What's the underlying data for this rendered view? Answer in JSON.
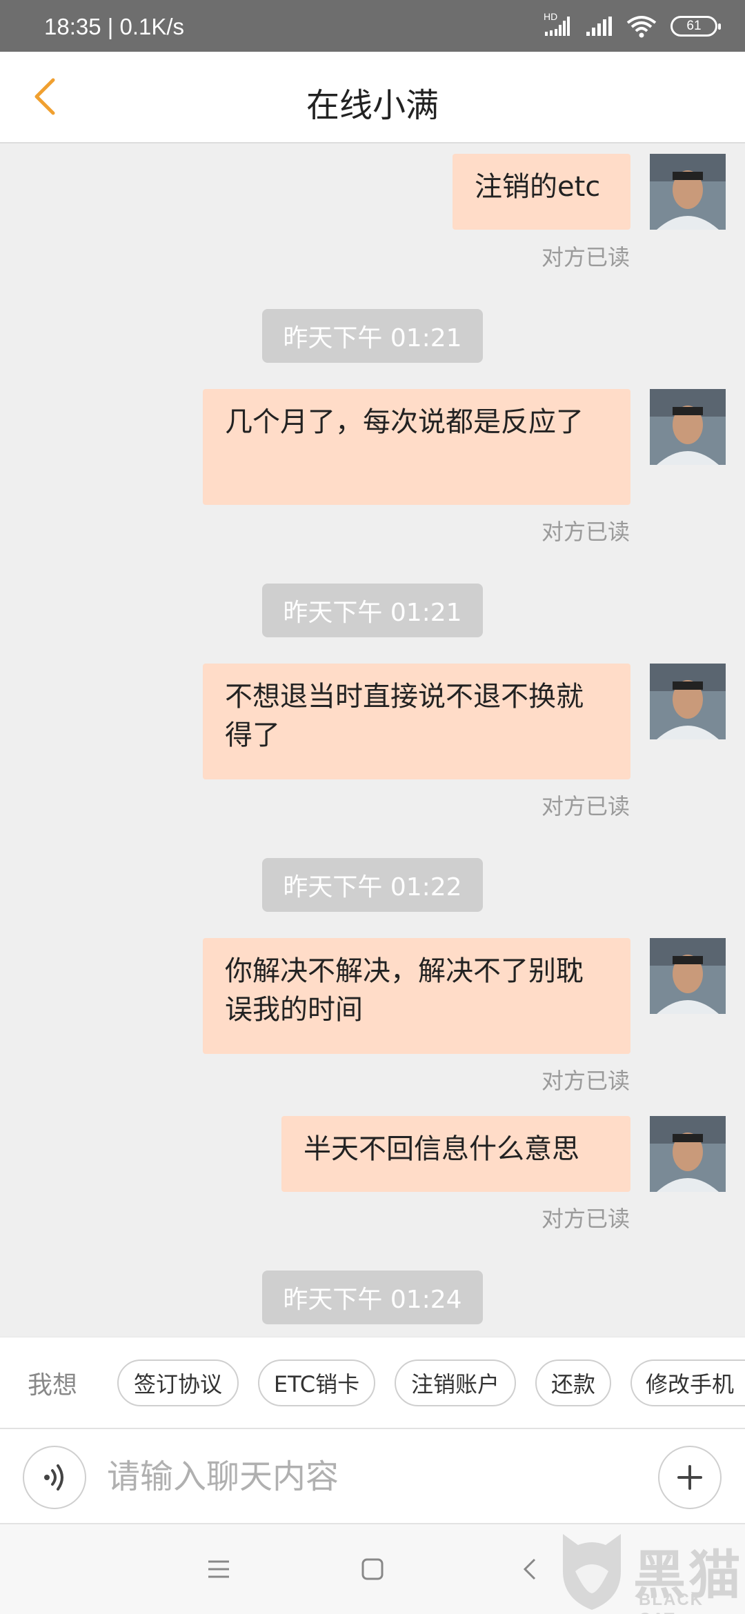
{
  "status_bar": {
    "time_speed": "18:35 | 0.1K/s",
    "signal_badge": "HD",
    "battery": "61"
  },
  "header": {
    "title": "在线小满"
  },
  "messages": [
    {
      "text": "注销的etc",
      "status": "对方已读"
    },
    {
      "time": "昨天下午 01:21"
    },
    {
      "text": "几个月了，每次说都是反应了",
      "status": "对方已读"
    },
    {
      "time": "昨天下午 01:21"
    },
    {
      "text": "不想退当时直接说不退不换就得了",
      "status": "对方已读"
    },
    {
      "time": "昨天下午 01:22"
    },
    {
      "text": "你解决不解决，解决不了别耽误我的时间",
      "status": "对方已读"
    },
    {
      "text": "半天不回信息什么意思",
      "status": "对方已读"
    },
    {
      "time": "昨天下午 01:24"
    }
  ],
  "quick_replies": {
    "label": "我想",
    "items": [
      "签订协议",
      "ETC销卡",
      "注销账户",
      "还款",
      "修改手机"
    ]
  },
  "input": {
    "placeholder": "请输入聊天内容"
  },
  "watermark": {
    "cn": "黑猫",
    "en": "BLACK CAT"
  },
  "colors": {
    "accent": "#f0a030",
    "bubble": "#ffdcc8",
    "background": "#efefef",
    "time_pill": "#cfcfcf"
  }
}
